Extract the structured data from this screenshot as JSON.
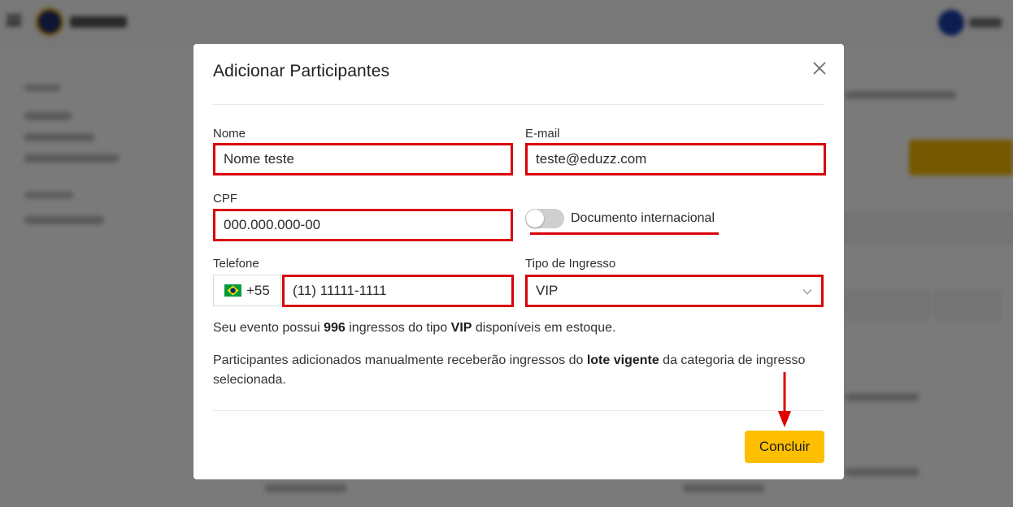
{
  "modal": {
    "title": "Adicionar Participantes",
    "close_icon": "close-icon"
  },
  "form": {
    "name": {
      "label": "Nome",
      "value": "Nome teste"
    },
    "email": {
      "label": "E-mail",
      "value": "teste@eduzz.com"
    },
    "cpf": {
      "label": "CPF",
      "value": "000.000.000-00"
    },
    "international_doc": {
      "label": "Documento internacional",
      "checked": false
    },
    "phone": {
      "label": "Telefone",
      "country_flag": "brazil-flag-icon",
      "country_code": "+55",
      "value": "(11) 11111-1111"
    },
    "ticket_type": {
      "label": "Tipo de Ingresso",
      "selected": "VIP",
      "icon": "chevron-down-icon"
    }
  },
  "stock_info": {
    "prefix": "Seu evento possui ",
    "count": "996",
    "middle": " ingressos do tipo ",
    "type": "VIP",
    "suffix": " disponíveis em estoque."
  },
  "lot_info": {
    "prefix": "Participantes adicionados manualmente receberão ingressos do ",
    "emphasis": "lote vigente",
    "suffix": " da categoria de ingresso selecionada."
  },
  "actions": {
    "submit_label": "Concluir"
  },
  "colors": {
    "highlight_red": "#d8000c",
    "primary_yellow": "#fdbf00",
    "overlay": "rgba(0,0,0,0.52)"
  }
}
